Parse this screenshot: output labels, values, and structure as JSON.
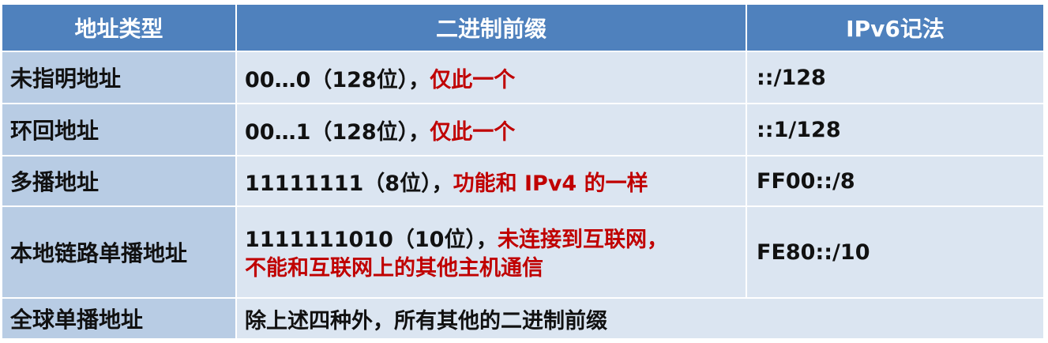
{
  "headers": [
    "地址类型",
    "二进制前缀",
    "IPv6记法"
  ],
  "rows": [
    {
      "type": "未指明地址",
      "prefix_black": "00…0（128位），",
      "prefix_red": "仅此一个",
      "notation": "::/128"
    },
    {
      "type": "环回地址",
      "prefix_black": "00…1（128位），",
      "prefix_red": "仅此一个",
      "notation": "::1/128"
    },
    {
      "type": "多播地址",
      "prefix_black": "11111111（8位），",
      "prefix_red": "功能和 IPv4 的一样",
      "notation": "FF00::/8"
    },
    {
      "type": "本地链路单播地址",
      "prefix_black": "1111111010（10位），",
      "prefix_red": "未连接到互联网，",
      "prefix_red_line2": "不能和互联网上的其他主机通信",
      "notation": "FE80::/10"
    },
    {
      "type": "全球单播地址",
      "prefix_black": "除上述四种外，所有其他的二进制前缀"
    }
  ],
  "colors": {
    "header_bg": "#4f81bd",
    "first_col_bg": "#b8cce4",
    "body_bg": "#dbe5f1",
    "emphasis": "#c00000"
  }
}
